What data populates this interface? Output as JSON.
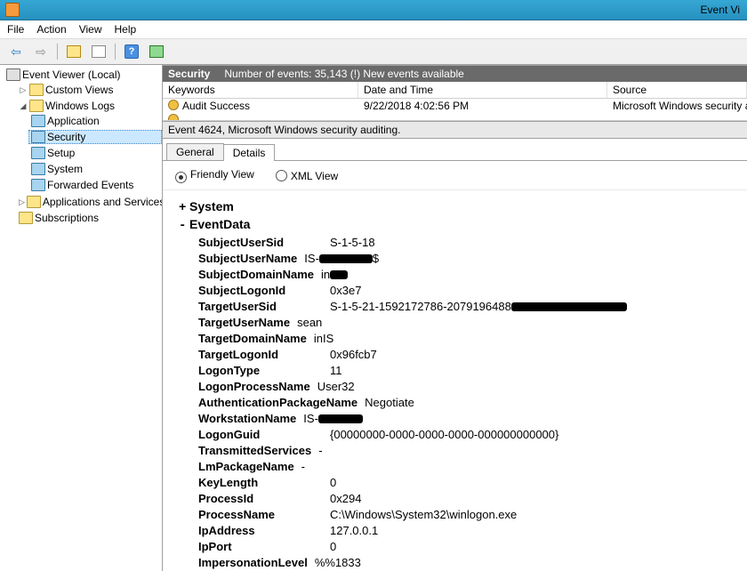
{
  "titlebar": {
    "title": "Event Vi"
  },
  "menubar": {
    "file": "File",
    "action": "Action",
    "view": "View",
    "help": "Help"
  },
  "tree": {
    "root": "Event Viewer (Local)",
    "custom": "Custom Views",
    "winlogs": "Windows Logs",
    "application": "Application",
    "security": "Security",
    "setup": "Setup",
    "system": "System",
    "forwarded": "Forwarded Events",
    "appservices": "Applications and Services Lo",
    "subscriptions": "Subscriptions"
  },
  "listpane": {
    "title": "Security",
    "subtitle": "Number of events: 35,143 (!) New events available",
    "cols": {
      "keywords": "Keywords",
      "datetime": "Date and Time",
      "source": "Source"
    },
    "row1": {
      "keywords": "Audit Success",
      "datetime": "9/22/2018 4:02:56 PM",
      "source": "Microsoft Windows security audit"
    }
  },
  "detail": {
    "header": "Event 4624, Microsoft Windows security auditing.",
    "tabs": {
      "general": "General",
      "details": "Details"
    },
    "view": {
      "friendly": "Friendly View",
      "xml": "XML View"
    },
    "system_label": "System",
    "eventdata_label": "EventData",
    "fields": {
      "SubjectUserSid": "S-1-5-18",
      "SubjectUserName_prefix": "IS-",
      "SubjectUserName_suffix": "$",
      "SubjectDomainName_prefix": "in",
      "SubjectLogonId": "0x3e7",
      "TargetUserSid_prefix": "S-1-5-21-1592172786-2079196488",
      "TargetUserName": "sean",
      "TargetDomainName": "inIS",
      "TargetLogonId": "0x96fcb7",
      "LogonType": "11",
      "LogonProcessName": "User32",
      "AuthenticationPackageName": "Negotiate",
      "WorkstationName_prefix": "IS-",
      "LogonGuid": "{00000000-0000-0000-0000-000000000000}",
      "TransmittedServices": "-",
      "LmPackageName": "-",
      "KeyLength": "0",
      "ProcessId": "0x294",
      "ProcessName": "C:\\Windows\\System32\\winlogon.exe",
      "IpAddress": "127.0.0.1",
      "IpPort": "0",
      "ImpersonationLevel": "%%1833"
    },
    "labels": {
      "SubjectUserSid": "SubjectUserSid",
      "SubjectUserName": "SubjectUserName",
      "SubjectDomainName": "SubjectDomainName",
      "SubjectLogonId": "SubjectLogonId",
      "TargetUserSid": "TargetUserSid",
      "TargetUserName": "TargetUserName",
      "TargetDomainName": "TargetDomainName",
      "TargetLogonId": "TargetLogonId",
      "LogonType": "LogonType",
      "LogonProcessName": "LogonProcessName",
      "AuthenticationPackageName": "AuthenticationPackageName",
      "WorkstationName": "WorkstationName",
      "LogonGuid": "LogonGuid",
      "TransmittedServices": "TransmittedServices",
      "LmPackageName": "LmPackageName",
      "KeyLength": "KeyLength",
      "ProcessId": "ProcessId",
      "ProcessName": "ProcessName",
      "IpAddress": "IpAddress",
      "IpPort": "IpPort",
      "ImpersonationLevel": "ImpersonationLevel"
    }
  }
}
